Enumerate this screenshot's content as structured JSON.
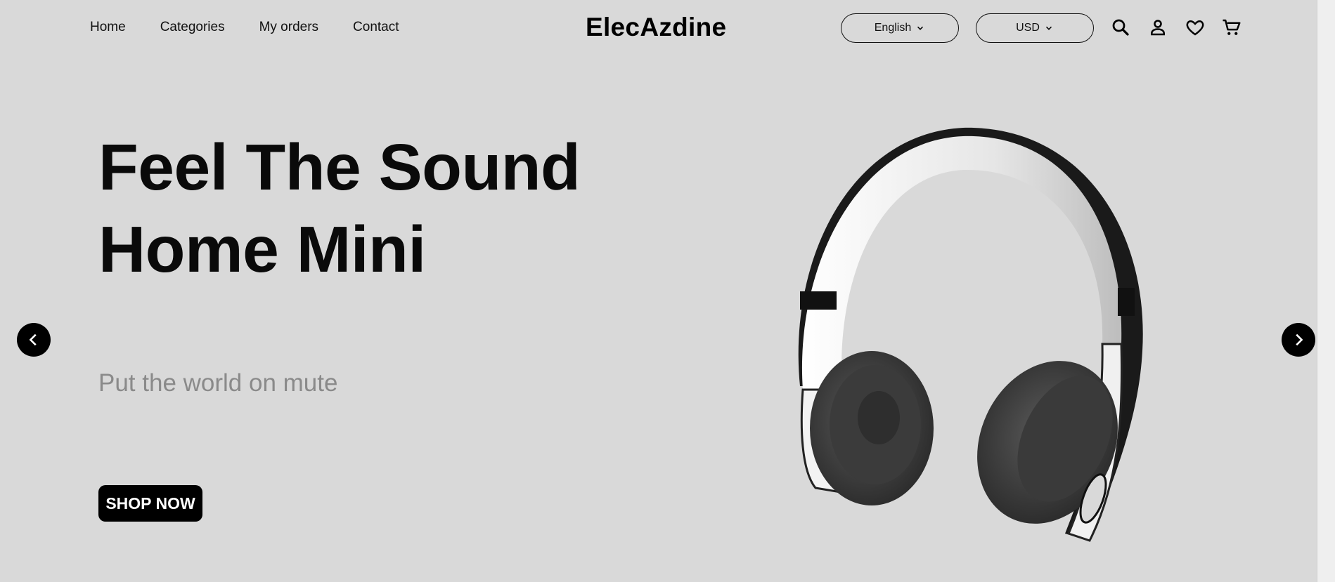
{
  "header": {
    "nav": [
      "Home",
      "Categories",
      "My orders",
      "Contact"
    ],
    "logo": "ElecAzdine",
    "language": "English",
    "currency": "USD",
    "icons": [
      "search-icon",
      "account-icon",
      "heart-icon",
      "cart-icon"
    ]
  },
  "hero": {
    "title_line1": "Feel The Sound",
    "title_line2": "Home Mini",
    "subtitle": "Put the world on mute",
    "cta": "SHOP NOW",
    "image": "headphones-image"
  },
  "carousel": {
    "prev_icon": "chevron-left-icon",
    "next_icon": "chevron-right-icon"
  },
  "colors": {
    "background": "#d9d9d9",
    "primary": "#000000",
    "subtitle": "#8a8a8a"
  }
}
